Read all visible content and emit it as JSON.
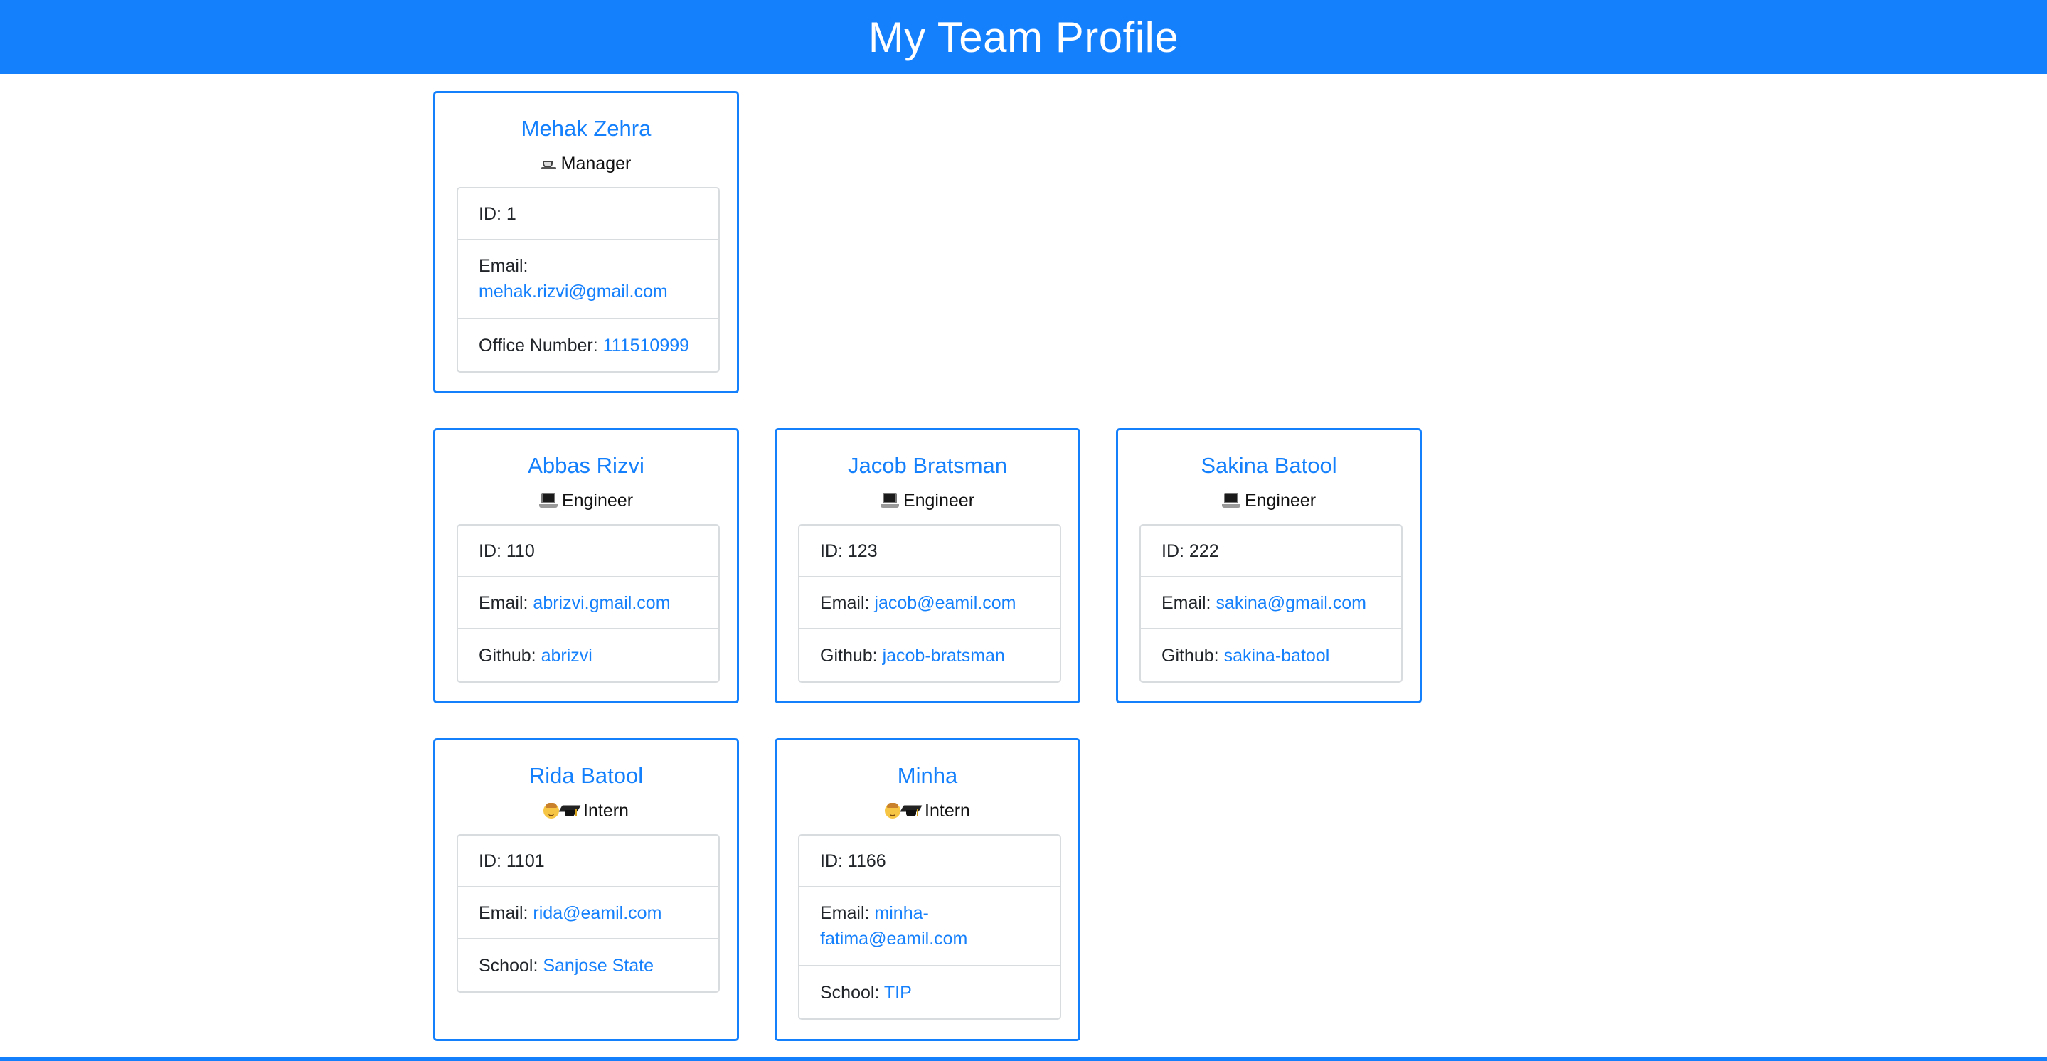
{
  "header": {
    "title": "My Team Profile",
    "bg_color": "#1580fb"
  },
  "colors": {
    "accent": "#1580fb",
    "border": "#d9dcdf"
  },
  "labels": {
    "id": "ID:",
    "email": "Email:",
    "office": "Office Number:",
    "github": "Github:",
    "school": "School:"
  },
  "manager": {
    "name": "Mehak Zehra",
    "role": "Manager",
    "role_icon": "coffee-cup-icon",
    "id": "1",
    "email": "mehak.rizvi@gmail.com",
    "office_number": "111510999"
  },
  "engineers": [
    {
      "name": "Abbas Rizvi",
      "role": "Engineer",
      "role_icon": "laptop-icon",
      "id": "110",
      "email": "abrizvi.gmail.com",
      "github": "abrizvi"
    },
    {
      "name": "Jacob Bratsman",
      "role": "Engineer",
      "role_icon": "laptop-icon",
      "id": "123",
      "email": "jacob@eamil.com",
      "github": "jacob-bratsman"
    },
    {
      "name": "Sakina Batool",
      "role": "Engineer",
      "role_icon": "laptop-icon",
      "id": "222",
      "email": "sakina@gmail.com",
      "github": "sakina-batool"
    }
  ],
  "interns": [
    {
      "name": "Rida Batool",
      "role": "Intern",
      "role_icon": "student-graduation-icon",
      "id": "1101",
      "email": "rida@eamil.com",
      "school": "Sanjose State"
    },
    {
      "name": "Minha",
      "role": "Intern",
      "role_icon": "student-graduation-icon",
      "id": "1166",
      "email_line1": "minha-",
      "email_line2": "fatima@eamil.com",
      "school": "TIP"
    }
  ]
}
